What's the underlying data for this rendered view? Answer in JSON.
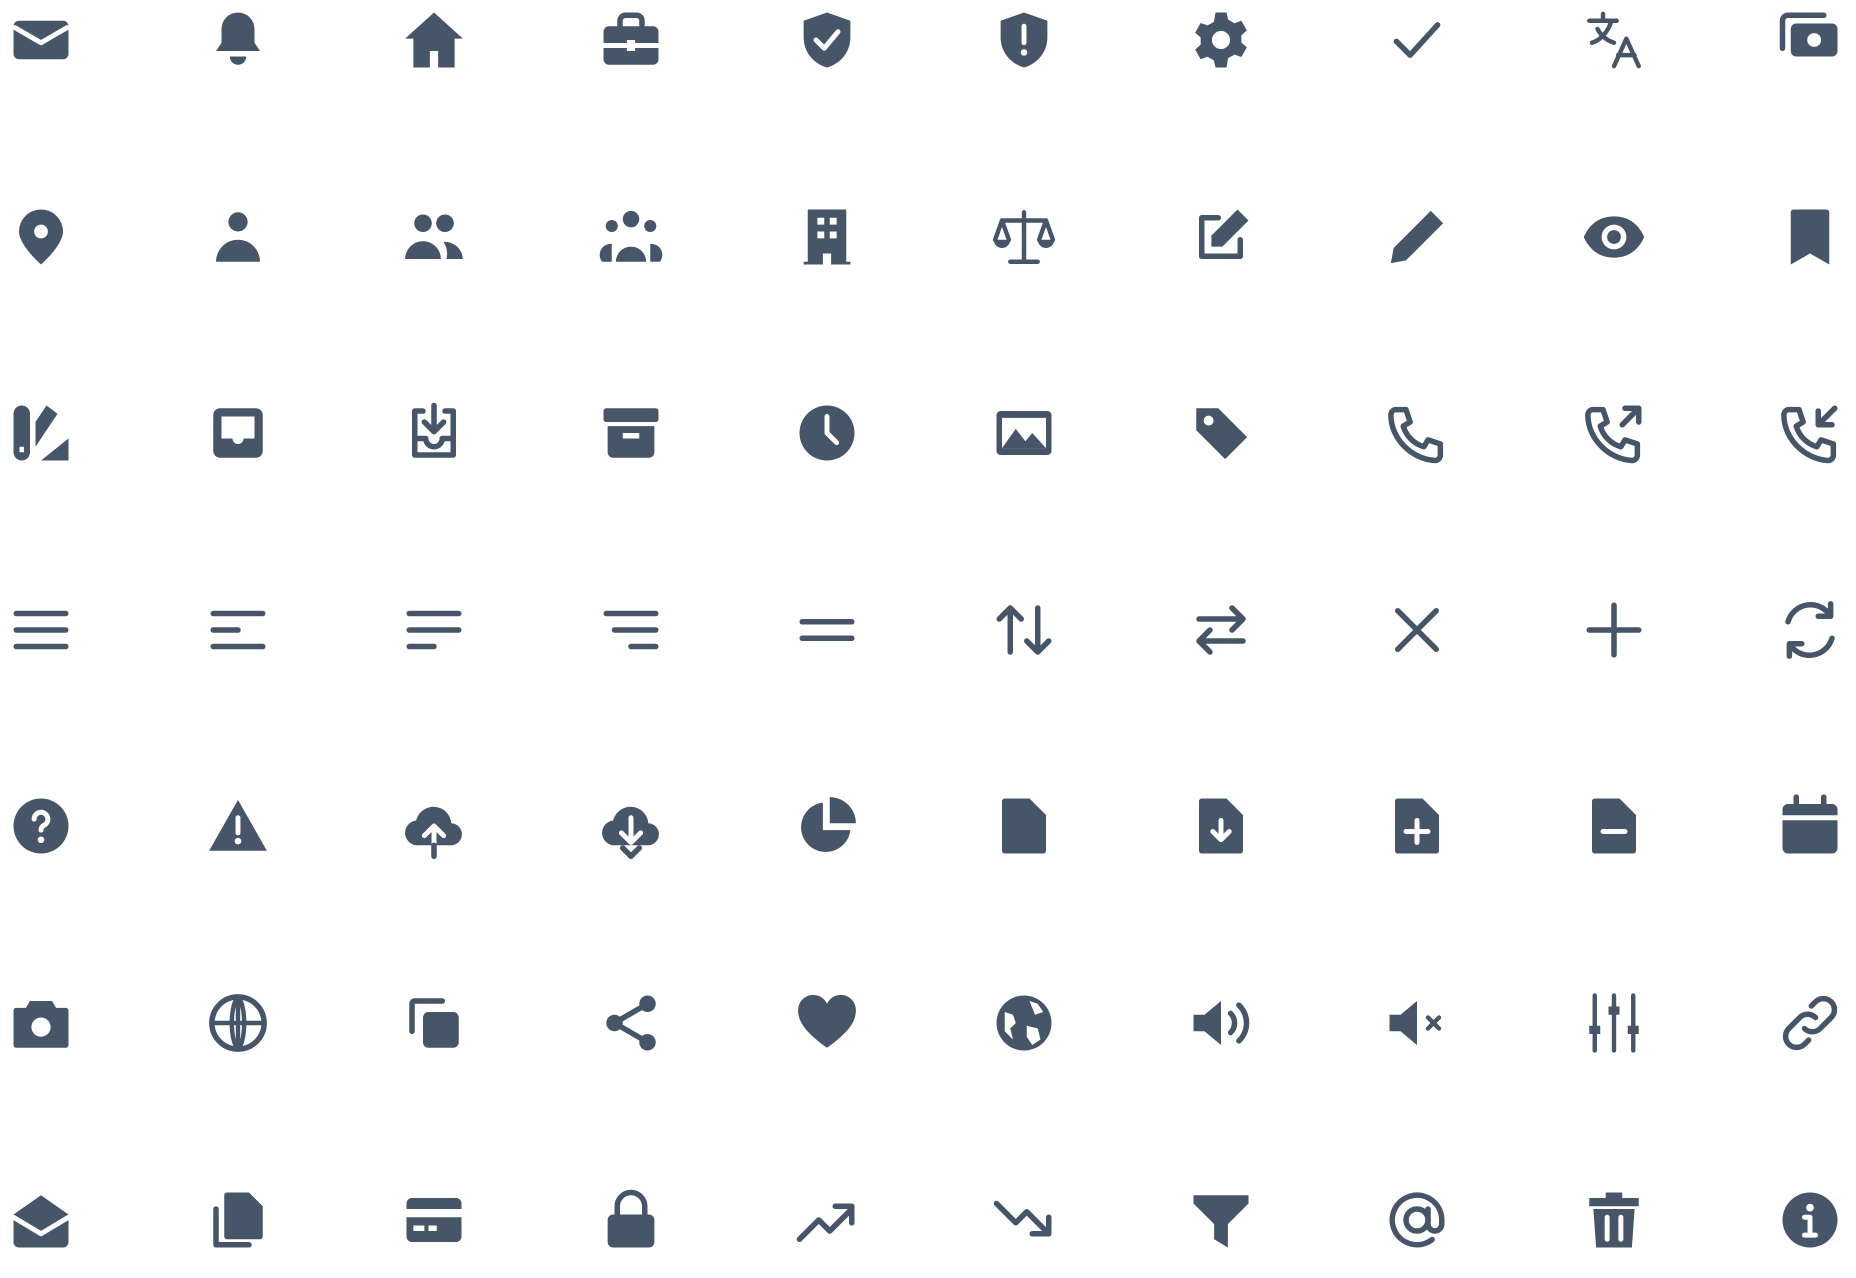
{
  "icon_color": "#475569",
  "background": "#ffffff",
  "icon_rows": [
    [
      "envelope",
      "bell",
      "home",
      "briefcase",
      "shield-check",
      "shield-exclamation",
      "cog",
      "check",
      "language",
      "banknotes"
    ],
    [
      "map-pin",
      "user",
      "users",
      "user-group",
      "building-office",
      "scale",
      "pencil-square",
      "pencil",
      "eye",
      "bookmark"
    ],
    [
      "swatch",
      "inbox",
      "inbox-arrow-down",
      "archive-box",
      "clock",
      "photo",
      "tag",
      "phone",
      "phone-arrow-up-right",
      "phone-arrow-down-left"
    ],
    [
      "bars-3",
      "bars-3-bottom-left",
      "bars-3-center-left",
      "bars-3-bottom-right",
      "bars-2",
      "arrows-up-down",
      "arrows-right-left",
      "x-mark",
      "plus",
      "arrow-path"
    ],
    [
      "question-mark-circle",
      "exclamation-triangle",
      "cloud-arrow-up",
      "cloud-arrow-down",
      "chart-pie",
      "document",
      "document-arrow-down",
      "document-plus",
      "document-minus",
      "calendar"
    ],
    [
      "camera",
      "globe-alt",
      "square-2-stack",
      "share",
      "heart",
      "globe-europe-africa",
      "speaker-wave",
      "speaker-x-mark",
      "adjustments-vertical",
      "link"
    ],
    [
      "envelope-open",
      "document-duplicate",
      "credit-card",
      "lock-closed",
      "arrow-trending-up",
      "arrow-trending-down",
      "funnel",
      "at-symbol",
      "trash",
      "information-circle"
    ]
  ]
}
